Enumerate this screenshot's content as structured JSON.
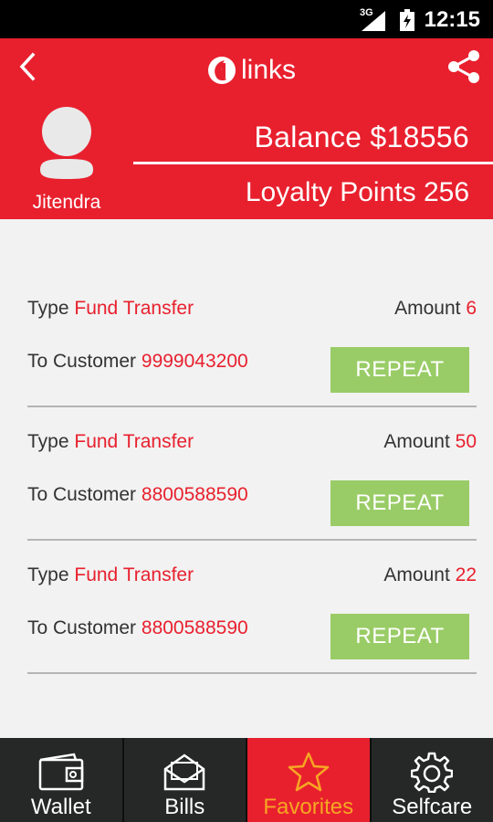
{
  "status_bar": {
    "network": "3G",
    "time": "12:15"
  },
  "header": {
    "logo_text": "links",
    "username": "Jitendra",
    "balance": "Balance $18556",
    "loyalty": "Loyalty Points 256"
  },
  "favorites": [
    {
      "type_label": "Type",
      "type_value": "Fund Transfer",
      "amount_label": "Amount",
      "amount_value": "6",
      "to_label": "To Customer",
      "to_value": "9999043200",
      "button": "REPEAT"
    },
    {
      "type_label": "Type",
      "type_value": "Fund Transfer",
      "amount_label": "Amount",
      "amount_value": "50",
      "to_label": "To Customer",
      "to_value": "8800588590",
      "button": "REPEAT"
    },
    {
      "type_label": "Type",
      "type_value": "Fund Transfer",
      "amount_label": "Amount",
      "amount_value": "22",
      "to_label": "To Customer",
      "to_value": "8800588590",
      "button": "REPEAT"
    }
  ],
  "nav": [
    {
      "label": "Wallet",
      "icon": "wallet-icon"
    },
    {
      "label": "Bills",
      "icon": "bills-icon"
    },
    {
      "label": "Favorites",
      "icon": "star-icon",
      "active": true
    },
    {
      "label": "Selfcare",
      "icon": "gear-icon"
    }
  ],
  "colors": {
    "brand_red": "#e8202e",
    "button_green": "#99cc66",
    "active_label": "#f6a623",
    "nav_bg": "#252826"
  }
}
